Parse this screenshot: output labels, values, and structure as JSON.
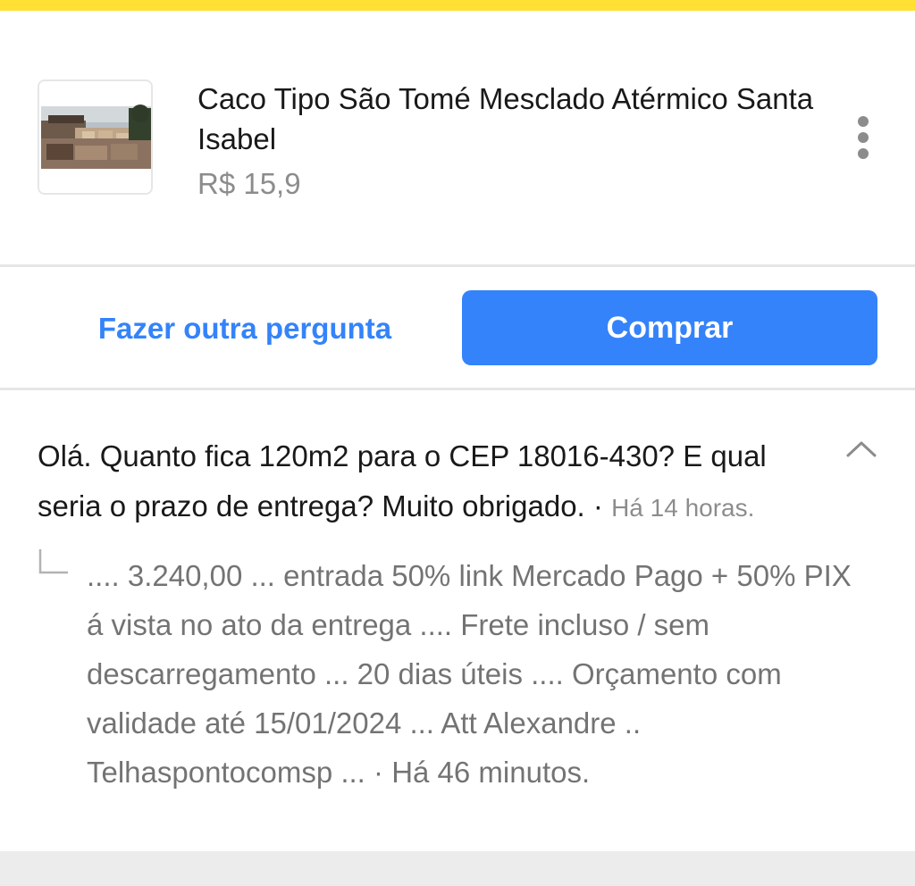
{
  "product": {
    "title": "Caco Tipo São Tomé Mesclado Atérmico Santa Isabel",
    "price": "R$ 15,9"
  },
  "actions": {
    "ask_again_label": "Fazer outra pergunta",
    "buy_label": "Comprar"
  },
  "question": {
    "text": "Olá. Quanto fica 120m2 para o CEP 18016-430? E qual seria o prazo de entrega? Muito obrigado.",
    "separator": "·",
    "time": "Há 14 horas."
  },
  "answer": {
    "text": ".... 3.240,00 ... entrada 50% link Mercado Pago + 50% PIX á vista no ato da entrega .... Frete incluso / sem descarregamento ... 20 dias úteis .... Orçamento com validade até 15/01/2024 ... Att Alexandre .. Telhaspontocomsp ...",
    "separator": "·",
    "time": "Há 46 minutos."
  },
  "icons": {
    "menu": "kebab-menu-icon",
    "collapse": "chevron-up-icon",
    "reply": "reply-corner-icon"
  },
  "colors": {
    "top_bar": "#ffe033",
    "accent": "#3483fa",
    "divider": "#e6e6e6",
    "footer": "#ececec"
  }
}
